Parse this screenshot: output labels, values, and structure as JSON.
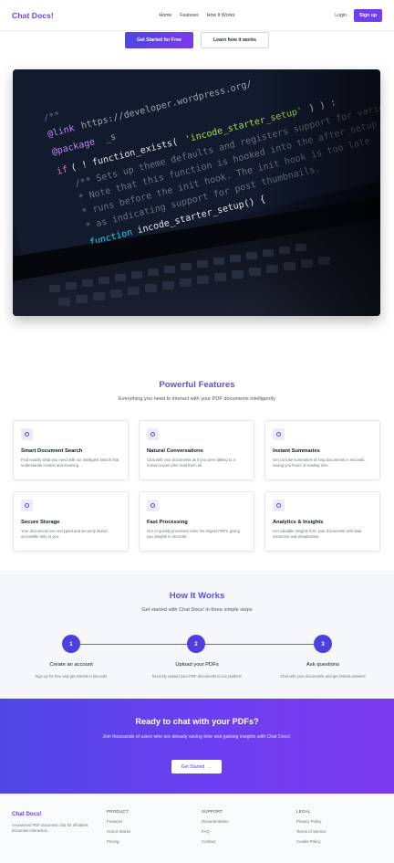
{
  "nav": {
    "brand": "Chat Docs!",
    "links": [
      "Home",
      "Features",
      "How It Works"
    ],
    "login": "Login",
    "signup": "Sign up"
  },
  "hero": {
    "primary_button": "Get Started for Free",
    "secondary_button": "Learn how it works"
  },
  "features": {
    "title": "Powerful Features",
    "subtitle": "Everything you need to interact with your PDF documents intelligently",
    "items": [
      {
        "icon": "search-icon",
        "title": "Smart Document Search",
        "desc": "Find exactly what you need with our intelligent search that understands context and meaning."
      },
      {
        "icon": "chat-icon",
        "title": "Natural Conversations",
        "desc": "Chat with your documents as if you were talking to a human expert who read them all."
      },
      {
        "icon": "document-icon",
        "title": "Instant Summaries",
        "desc": "Get concise summaries of long documents in seconds, saving you hours of reading time."
      },
      {
        "icon": "storage-icon",
        "title": "Secure Storage",
        "desc": "Your documents are encrypted and securely stored, accessible only to you."
      },
      {
        "icon": "bolt-icon",
        "title": "Fast Processing",
        "desc": "Our AI quickly processes even the largest PDFs, giving you insights in seconds."
      },
      {
        "icon": "chart-icon",
        "title": "Analytics & Insights",
        "desc": "Get valuable insights from your documents with data extraction and visualization."
      }
    ]
  },
  "how": {
    "title": "How It Works",
    "subtitle": "Get started with Chat Docs! in three simple steps",
    "steps": [
      {
        "num": "1",
        "title": "Create an account",
        "desc": "Sign up for free and get started in seconds"
      },
      {
        "num": "2",
        "title": "Upload your PDFs",
        "desc": "Securely upload your PDF documents to our platform"
      },
      {
        "num": "3",
        "title": "Ask questions",
        "desc": "Chat with your documents and get instant answers"
      }
    ]
  },
  "cta": {
    "title": "Ready to chat with your PDFs?",
    "desc": "Join thousands of users who are already saving time and gaining insights with Chat Docs!.",
    "button": "Get Started",
    "button_icon": "arrow-right-icon"
  },
  "footer": {
    "brand": "Chat Docs!",
    "desc": "AI-powered PDF document chat for effortless document interaction.",
    "columns": [
      {
        "heading": "PRODUCT",
        "links": [
          "Features",
          "How It Works",
          "Pricing"
        ]
      },
      {
        "heading": "SUPPORT",
        "links": [
          "Documentation",
          "FAQ",
          "Contact"
        ]
      },
      {
        "heading": "LEGAL",
        "links": [
          "Privacy Policy",
          "Terms of Service",
          "Cookie Policy"
        ]
      }
    ]
  },
  "colors": {
    "accent": "#6d3ff2",
    "accent_dark": "#4f46e5",
    "title_purple": "#5b4fe0"
  }
}
